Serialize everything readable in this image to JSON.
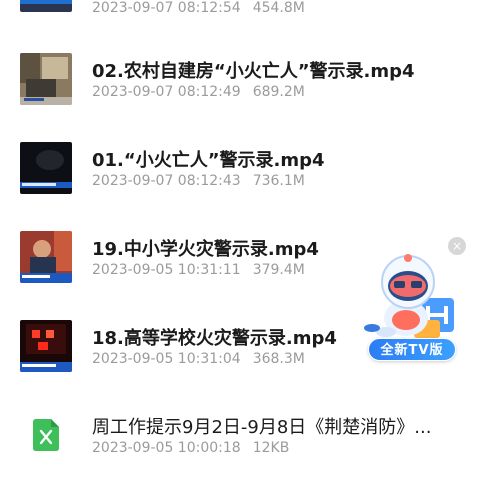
{
  "files": [
    {
      "name": "",
      "date": "2023-09-07 08:12:54",
      "size": "454.8M",
      "thumb": "partial-video-thumb"
    },
    {
      "name": "02.农村自建房“小火亡人”警示录.mp4",
      "date": "2023-09-07 08:12:49",
      "size": "689.2M",
      "thumb": "room-scene-thumb"
    },
    {
      "name": "01.“小火亡人”警示录.mp4",
      "date": "2023-09-07 08:12:43",
      "size": "736.1M",
      "thumb": "dark-scene-thumb"
    },
    {
      "name": "19.中小学火灾警示录.mp4",
      "date": "2023-09-05 10:31:11",
      "size": "379.4M",
      "thumb": "person-interview-thumb"
    },
    {
      "name": "18.高等学校火灾警示录.mp4",
      "date": "2023-09-05 10:31:04",
      "size": "368.3M",
      "thumb": "fire-scene-thumb"
    },
    {
      "name": "周工作提示9月2日-9月8日《荆楚消防》...",
      "date": "2023-09-05 10:00:18",
      "size": "12KB",
      "thumb": "excel-file-icon"
    }
  ],
  "ad": {
    "badge": "全新TV版",
    "close_label": "×",
    "mascot": "astronaut-mascot-icon"
  },
  "colors": {
    "title": "#1b1b1b",
    "meta": "#9b9b9b",
    "excel_green": "#3fbf5a",
    "badge_blue": "#2d7cf5"
  }
}
